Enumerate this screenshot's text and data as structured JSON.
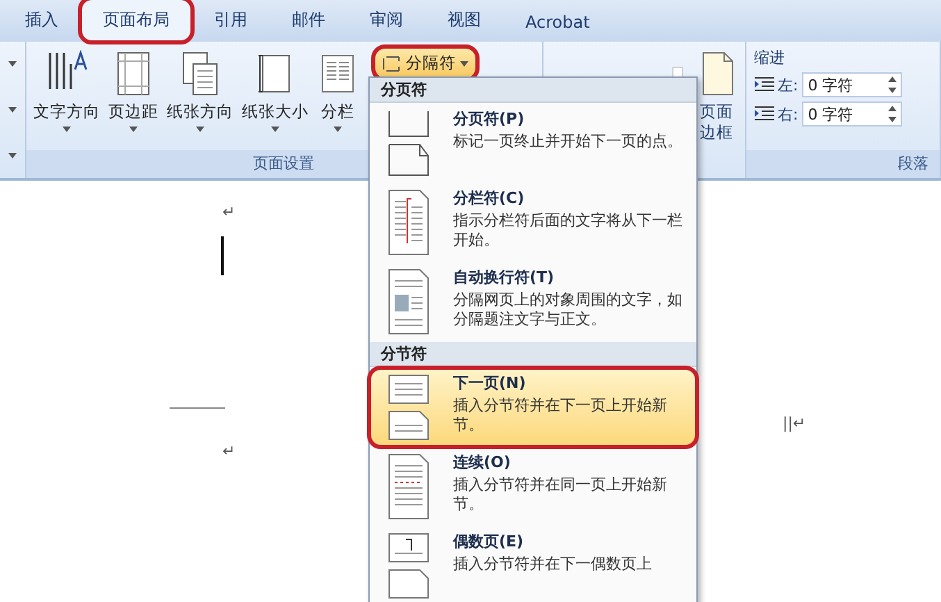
{
  "tabs": [
    {
      "label": "插入",
      "selected": false,
      "circled": false
    },
    {
      "label": "页面布局",
      "selected": true,
      "circled": true
    },
    {
      "label": "引用",
      "selected": false,
      "circled": false
    },
    {
      "label": "邮件",
      "selected": false,
      "circled": false
    },
    {
      "label": "审阅",
      "selected": false,
      "circled": false
    },
    {
      "label": "视图",
      "selected": false,
      "circled": false
    },
    {
      "label": "Acrobat",
      "selected": false,
      "circled": false
    }
  ],
  "page_setup": {
    "buttons": [
      {
        "label": "文字方向",
        "kind": "text-direction"
      },
      {
        "label": "页边距",
        "kind": "margins"
      },
      {
        "label": "纸张方向",
        "kind": "orientation"
      },
      {
        "label": "纸张大小",
        "kind": "size"
      },
      {
        "label": "分栏",
        "kind": "columns"
      }
    ],
    "breaks_button": {
      "label": "分隔符",
      "circled": true,
      "expanded": true
    },
    "group_label": "页面设置"
  },
  "page_background": {
    "border_button": "页面边框"
  },
  "paragraph": {
    "indent_title": "缩进",
    "fields": [
      {
        "label": "左:",
        "value": "0 字符"
      },
      {
        "label": "右:",
        "value": "0 字符"
      }
    ],
    "group_label": "段落"
  },
  "menu": {
    "sections": [
      {
        "header": "分页符",
        "items": [
          {
            "title": "分页符(P)",
            "description": "标记一页终止并开始下一页的点。",
            "kind": "page-break",
            "selected": false,
            "circled": false
          },
          {
            "title": "分栏符(C)",
            "description": "指示分栏符后面的文字将从下一栏开始。",
            "kind": "column-break",
            "selected": false,
            "circled": false
          },
          {
            "title": "自动换行符(T)",
            "description": "分隔网页上的对象周围的文字，如分隔题注文字与正文。",
            "kind": "text-wrap",
            "selected": false,
            "circled": false
          }
        ]
      },
      {
        "header": "分节符",
        "items": [
          {
            "title": "下一页(N)",
            "description": "插入分节符并在下一页上开始新节。",
            "kind": "next-page",
            "selected": true,
            "circled": true
          },
          {
            "title": "连续(O)",
            "description": "插入分节符并在同一页上开始新节。",
            "kind": "continuous",
            "selected": false,
            "circled": false
          },
          {
            "title": "偶数页(E)",
            "description": "插入分节符并在下一偶数页上",
            "kind": "even-page",
            "selected": false,
            "circled": false
          }
        ]
      }
    ]
  },
  "document": {
    "top_mark": "↵",
    "bottom_mark": "↵",
    "side_mark": "||↵"
  }
}
